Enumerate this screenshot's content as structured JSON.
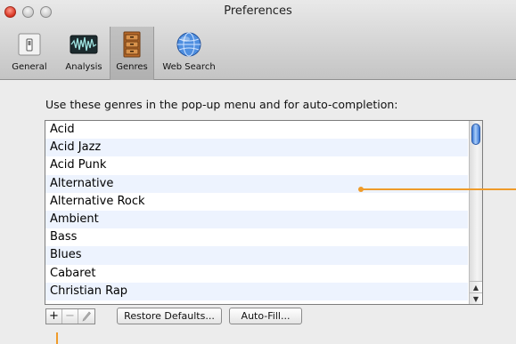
{
  "window": {
    "title": "Preferences"
  },
  "toolbar": {
    "items": [
      {
        "label": "General",
        "icon": "switch-icon"
      },
      {
        "label": "Analysis",
        "icon": "waveform-icon"
      },
      {
        "label": "Genres",
        "icon": "cabinet-icon",
        "selected": true
      },
      {
        "label": "Web Search",
        "icon": "globe-icon"
      }
    ]
  },
  "instruction": "Use these genres in the pop-up menu and for auto-completion:",
  "genres": [
    "Acid",
    "Acid Jazz",
    "Acid Punk",
    "Alternative",
    "Alternative Rock",
    "Ambient",
    "Bass",
    "Blues",
    "Cabaret",
    "Christian Rap"
  ],
  "buttons": {
    "add": "+",
    "remove": "−",
    "restore_defaults": "Restore Defaults...",
    "auto_fill": "Auto-Fill..."
  },
  "colors": {
    "callout": "#ef9b2a",
    "alt_row": "#edf3fe",
    "scroll_thumb": "#3b78d6"
  }
}
